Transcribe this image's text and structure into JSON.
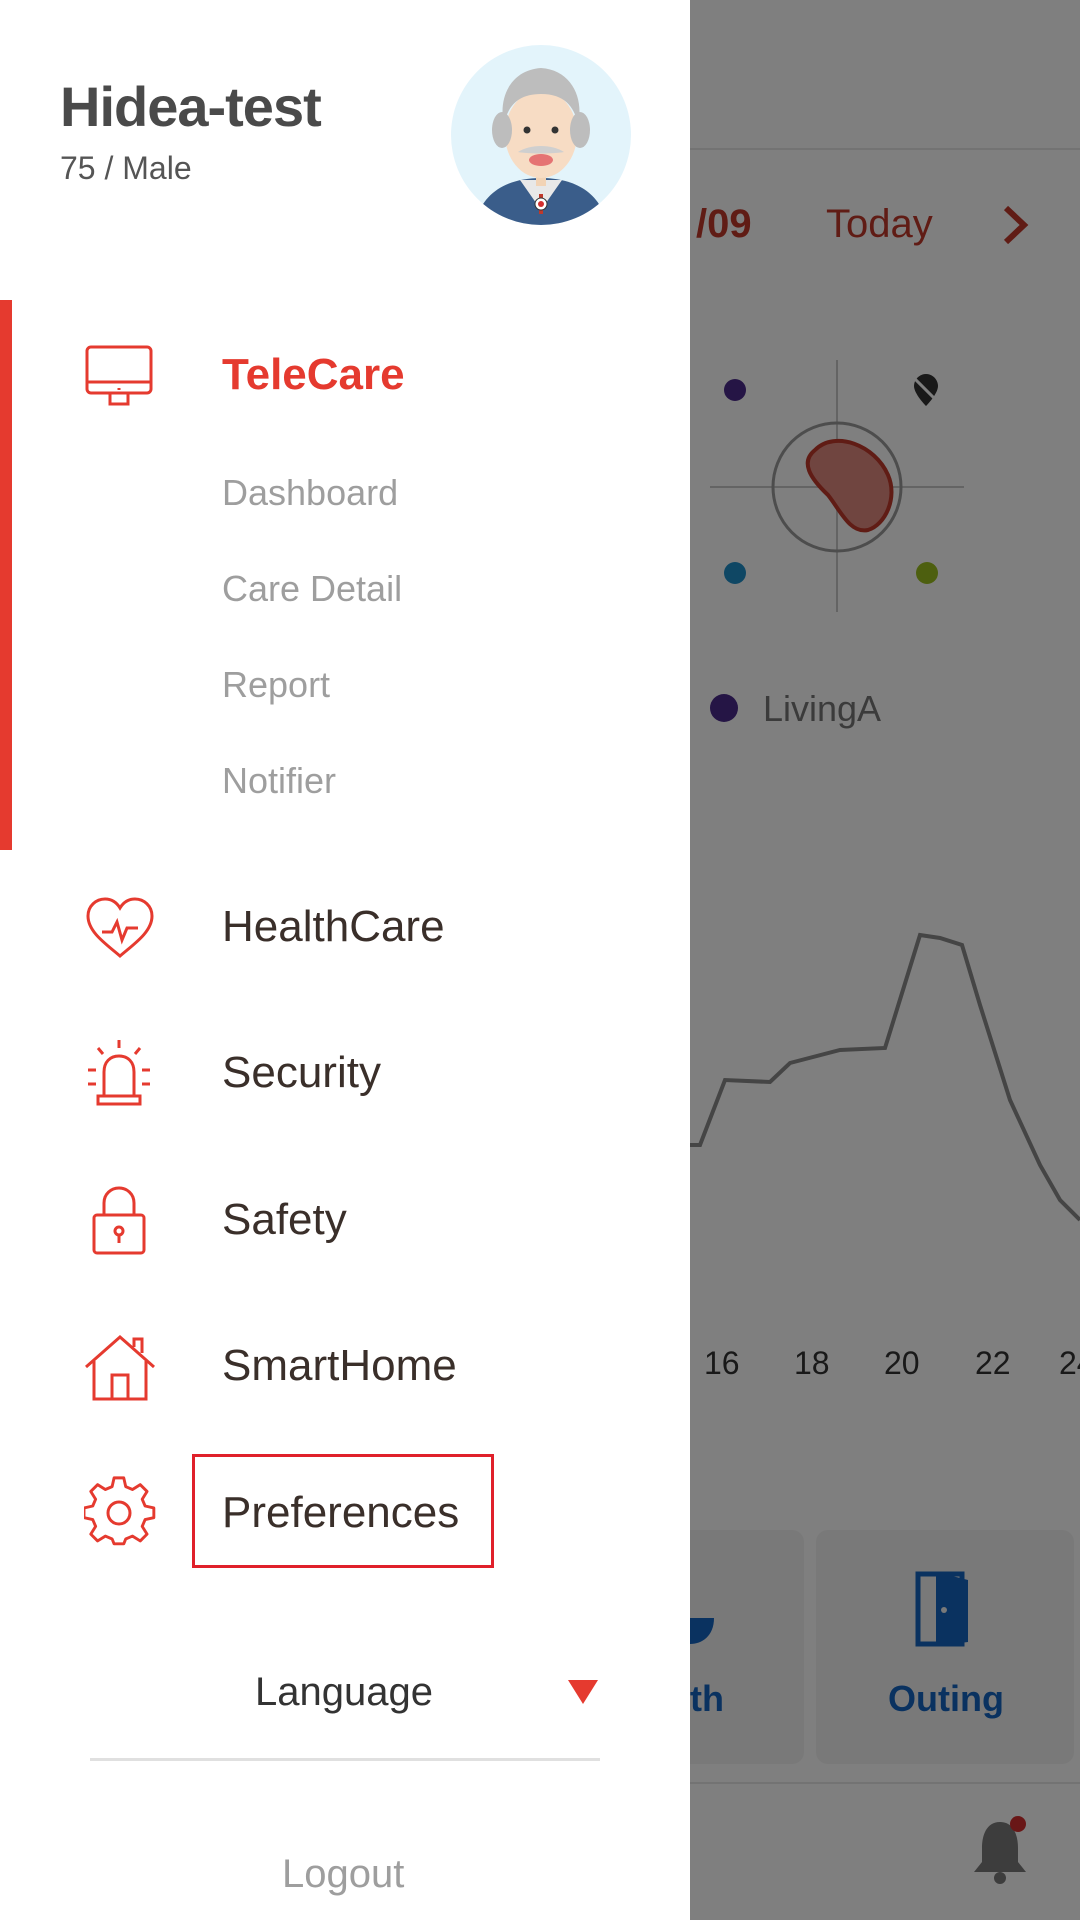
{
  "background": {
    "date_fragment": "/09",
    "today_label": "Today",
    "room_label": "LivingA",
    "axis_ticks": [
      "16",
      "18",
      "20",
      "22",
      "24"
    ],
    "tile_partial_label": "th",
    "outing_label": "Outing",
    "colors": {
      "accent_red": "#c0392b",
      "outing_blue": "#1565c0"
    }
  },
  "profile": {
    "name": "Hidea-test",
    "details": "75 / Male"
  },
  "nav": {
    "telecare": {
      "label": "TeleCare",
      "sub_items": [
        "Dashboard",
        "Care Detail",
        "Report",
        "Notifier"
      ]
    },
    "healthcare": {
      "label": "HealthCare"
    },
    "security": {
      "label": "Security"
    },
    "safety": {
      "label": "Safety"
    },
    "smarthome": {
      "label": "SmartHome"
    },
    "preferences": {
      "label": "Preferences"
    }
  },
  "language": {
    "label": "Language"
  },
  "logout": {
    "label": "Logout"
  },
  "icons": {
    "telecare": "monitor-icon",
    "healthcare": "heartbeat-icon",
    "security": "siren-icon",
    "safety": "lock-icon",
    "smarthome": "home-icon",
    "preferences": "gear-icon"
  },
  "colors": {
    "accent": "#e53a2f",
    "text_dark": "#3a2f2a",
    "text_muted": "#9e9e9e",
    "highlight_box": "#e0202a"
  }
}
